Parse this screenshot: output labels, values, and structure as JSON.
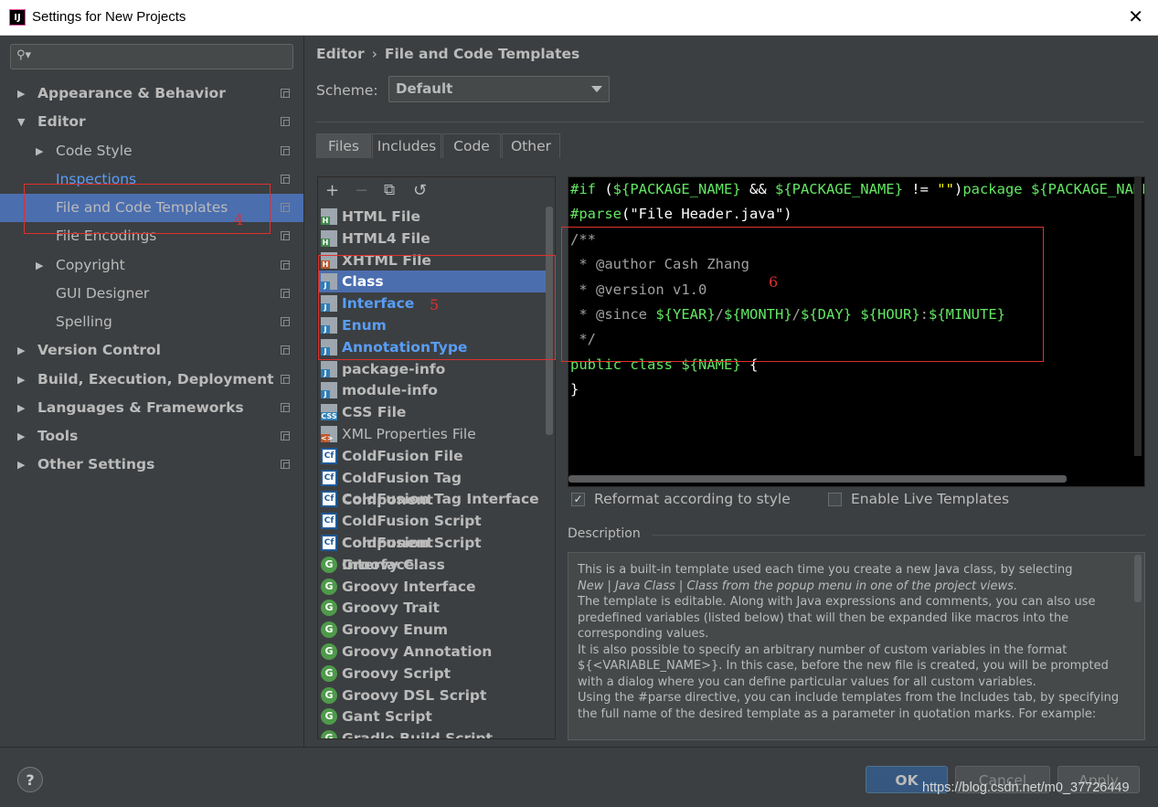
{
  "window": {
    "title": "Settings for New Projects",
    "app_icon_text": "IJ"
  },
  "search": {
    "placeholder": ""
  },
  "nav": [
    {
      "label": "Appearance & Behavior",
      "expanded": false,
      "bold": true
    },
    {
      "label": "Editor",
      "expanded": true,
      "bold": true
    },
    {
      "label": "Code Style",
      "expanded": false,
      "bold": false
    },
    {
      "label": "Inspections",
      "bold": false
    },
    {
      "label": "File and Code Templates",
      "bold": false,
      "selected": true
    },
    {
      "label": "File Encodings",
      "bold": false
    },
    {
      "label": "Copyright",
      "expanded": false,
      "bold": false
    },
    {
      "label": "GUI Designer",
      "bold": false
    },
    {
      "label": "Spelling",
      "bold": false
    },
    {
      "label": "Version Control",
      "expanded": false,
      "bold": true
    },
    {
      "label": "Build, Execution, Deployment",
      "expanded": false,
      "bold": true
    },
    {
      "label": "Languages & Frameworks",
      "expanded": false,
      "bold": true
    },
    {
      "label": "Tools",
      "expanded": false,
      "bold": true
    },
    {
      "label": "Other Settings",
      "expanded": false,
      "bold": true
    }
  ],
  "breadcrumb": {
    "parent": "Editor",
    "separator": "›",
    "current": "File and Code Templates"
  },
  "scheme": {
    "label": "Scheme:",
    "value": "Default"
  },
  "tabs": [
    {
      "label": "Files",
      "active": true
    },
    {
      "label": "Includes"
    },
    {
      "label": "Code"
    },
    {
      "label": "Other"
    }
  ],
  "toolbar": {
    "add": "+",
    "remove": "−",
    "copy": "⧉",
    "reset": "↺"
  },
  "templates": [
    {
      "label": "HTML File",
      "icon": "file-icon",
      "badge": "H",
      "badge_color": "#3d8a4a"
    },
    {
      "label": "HTML4 File",
      "icon": "file-icon",
      "badge": "H",
      "badge_color": "#3d8a4a"
    },
    {
      "label": "XHTML File",
      "icon": "file-icon",
      "badge": "H",
      "badge_color": "#c0582a"
    },
    {
      "label": "Class",
      "icon": "java-class-icon",
      "badge": "J",
      "badge_color": "#2e7fb8",
      "selected": true
    },
    {
      "label": "Interface",
      "icon": "java-interface-icon",
      "badge": "J",
      "badge_color": "#2e7fb8",
      "blue": true
    },
    {
      "label": "Enum",
      "icon": "java-enum-icon",
      "badge": "J",
      "badge_color": "#2e7fb8",
      "blue": true
    },
    {
      "label": "AnnotationType",
      "icon": "java-annotation-icon",
      "badge": "J",
      "badge_color": "#2e7fb8",
      "blue": true
    },
    {
      "label": "package-info",
      "icon": "java-file-icon",
      "badge": "J",
      "badge_color": "#2e7fb8"
    },
    {
      "label": "module-info",
      "icon": "java-file-icon",
      "badge": "J",
      "badge_color": "#2e7fb8"
    },
    {
      "label": "CSS File",
      "icon": "css-file-icon",
      "badge": "CSS",
      "badge_color": "#2e7fb8"
    },
    {
      "label": "XML Properties File",
      "icon": "xml-file-icon",
      "badge": "<>",
      "badge_color": "#c0582a",
      "normal": true
    },
    {
      "label": "ColdFusion File",
      "icon": "coldfusion-icon",
      "badge": "Cf"
    },
    {
      "label": "ColdFusion Tag Component",
      "icon": "coldfusion-icon",
      "badge": "Cf"
    },
    {
      "label": "ColdFusion Tag Interface",
      "icon": "coldfusion-icon",
      "badge": "Cf"
    },
    {
      "label": "ColdFusion Script Component",
      "icon": "coldfusion-icon",
      "badge": "Cf"
    },
    {
      "label": "ColdFusion Script Interface",
      "icon": "coldfusion-icon",
      "badge": "Cf"
    },
    {
      "label": "Groovy Class",
      "icon": "groovy-icon",
      "badge": "G"
    },
    {
      "label": "Groovy Interface",
      "icon": "groovy-icon",
      "badge": "G"
    },
    {
      "label": "Groovy Trait",
      "icon": "groovy-icon",
      "badge": "G"
    },
    {
      "label": "Groovy Enum",
      "icon": "groovy-icon",
      "badge": "G"
    },
    {
      "label": "Groovy Annotation",
      "icon": "groovy-icon",
      "badge": "G"
    },
    {
      "label": "Groovy Script",
      "icon": "groovy-icon",
      "badge": "G"
    },
    {
      "label": "Groovy DSL Script",
      "icon": "groovy-icon",
      "badge": "G"
    },
    {
      "label": "Gant Script",
      "icon": "groovy-icon",
      "badge": "G"
    },
    {
      "label": "Gradle Build Script",
      "icon": "groovy-icon",
      "badge": "G"
    }
  ],
  "editor": {
    "lines": [
      [
        {
          "t": "#if",
          "c": "kw"
        },
        {
          "t": " ("
        },
        {
          "t": "${PACKAGE_NAME}",
          "c": "var"
        },
        {
          "t": " && "
        },
        {
          "t": "${PACKAGE_NAME}",
          "c": "var"
        },
        {
          "t": " != "
        },
        {
          "t": "\"\"",
          "c": "str"
        },
        {
          "t": ")"
        },
        {
          "t": "package ",
          "c": "kw"
        },
        {
          "t": "${PACKAGE_NAME}",
          "c": "var"
        },
        {
          "t": ";"
        }
      ],
      [
        {
          "t": "#parse",
          "c": "kw"
        },
        {
          "t": "(\"File Header.java\")"
        }
      ],
      [
        {
          "t": "/**",
          "c": "cm"
        }
      ],
      [
        {
          "t": " * @author Cash Zhang",
          "c": "cm"
        }
      ],
      [
        {
          "t": " * @version v1.0",
          "c": "cm"
        }
      ],
      [
        {
          "t": " * @since ",
          "c": "cm"
        },
        {
          "t": "${YEAR}",
          "c": "var"
        },
        {
          "t": "/",
          "c": "cm"
        },
        {
          "t": "${MONTH}",
          "c": "var"
        },
        {
          "t": "/",
          "c": "cm"
        },
        {
          "t": "${DAY}",
          "c": "var"
        },
        {
          "t": " ",
          "c": "cm"
        },
        {
          "t": "${HOUR}",
          "c": "var"
        },
        {
          "t": ":",
          "c": "cm"
        },
        {
          "t": "${MINUTE}",
          "c": "var"
        }
      ],
      [
        {
          "t": " */",
          "c": "cm"
        }
      ],
      [
        {
          "t": "public class ",
          "c": "kw"
        },
        {
          "t": "${NAME}",
          "c": "var"
        },
        {
          "t": " {"
        }
      ],
      [
        {
          "t": "}"
        }
      ]
    ]
  },
  "options": {
    "reformat": {
      "label": "Reformat according to style",
      "checked": true
    },
    "live_templates": {
      "label": "Enable Live Templates",
      "checked": false
    }
  },
  "description": {
    "title": "Description",
    "paragraphs": [
      "This is a built-in template used each time you create a new Java class, by selecting",
      "New | Java Class | Class from the popup menu in one of the project views.",
      "The template is editable. Along with Java expressions and comments, you can also use predefined variables (listed below) that will then be expanded like macros into the corresponding values.",
      "It is also possible to specify an arbitrary number of custom variables in the format ${<VARIABLE_NAME>}. In this case, before the new file is created, you will be prompted with a dialog where you can define particular values for all custom variables.",
      "Using the #parse directive, you can include templates from the Includes tab, by specifying the full name of the desired template as a parameter in quotation marks. For example:"
    ]
  },
  "buttons": {
    "help": "?",
    "ok": "OK",
    "cancel": "Cancel",
    "apply": "Apply"
  },
  "watermark": "https://blog.csdn.net/m0_37726449",
  "annotations": [
    "4",
    "5",
    "6"
  ],
  "colors": {
    "accent": "#4b6eaf",
    "annotation": "#e0302f",
    "keyword": "#63e863"
  }
}
